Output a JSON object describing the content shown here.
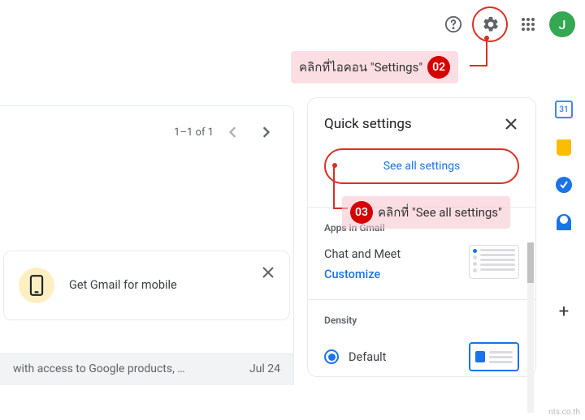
{
  "header": {
    "avatar_initial": "J",
    "cal_day": "31"
  },
  "callouts": {
    "step02_label": "คลิกที่ไอคอน \"Settings\"",
    "step02_num": "02",
    "step03_label": "คลิกที่ \"See all settings\"",
    "step03_num": "03"
  },
  "pager": {
    "count": "1–1 of 1"
  },
  "promo": {
    "text": "Get Gmail for mobile"
  },
  "footer": {
    "text": "with access to Google products, …",
    "date": "Jul 24"
  },
  "panel": {
    "title": "Quick settings",
    "see_all": "See all settings",
    "apps_title": "Apps in Gmail",
    "chat_label": "Chat and Meet",
    "customize": "Customize",
    "density_title": "Density",
    "density_default": "Default"
  },
  "watermark": "nts.co.th"
}
